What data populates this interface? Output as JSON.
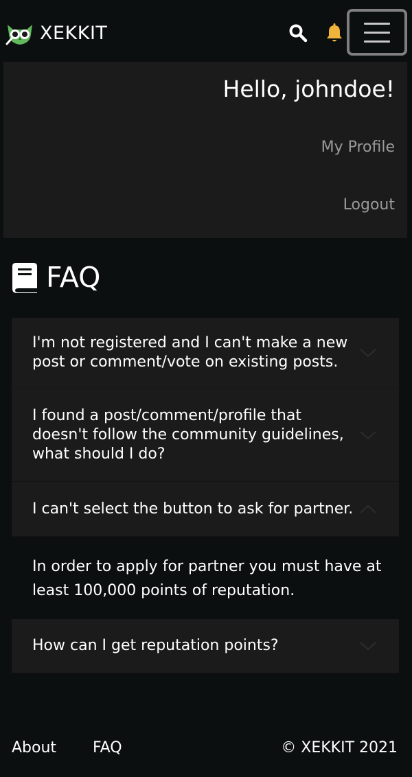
{
  "navbar": {
    "brand_name": "XEKKIT",
    "logo_icon": "owl-logo-icon",
    "search_icon": "search-icon",
    "bell_icon": "bell-icon",
    "menu_icon": "hamburger-menu-icon",
    "colors": {
      "logo_green": "#62b85c",
      "bell": "#f0b43a",
      "toggler_border": "#7f7f7f"
    }
  },
  "menu": {
    "greeting": "Hello, johndoe!",
    "profile_label": "My Profile",
    "logout_label": "Logout"
  },
  "faq": {
    "title": "FAQ",
    "icon": "book-icon",
    "items": [
      {
        "question": "I'm not registered and I can't make a new post or comment/vote on existing posts.",
        "expanded": false
      },
      {
        "question": "I found a post/comment/profile that doesn't follow the community guidelines, what should I do?",
        "expanded": false
      },
      {
        "question": "I can't select the button to ask for partner.",
        "expanded": true,
        "answer": "In order to apply for partner you must have at least 100,000 points of reputation."
      },
      {
        "question": "How can I get reputation points?",
        "expanded": false
      }
    ]
  },
  "footer": {
    "about_label": "About",
    "faq_label": "FAQ",
    "copyright": "© XEKKIT 2021"
  },
  "colors": {
    "background": "#0b0f0f",
    "panel": "#1b1b1c",
    "muted_text": "#9a9a9a"
  }
}
